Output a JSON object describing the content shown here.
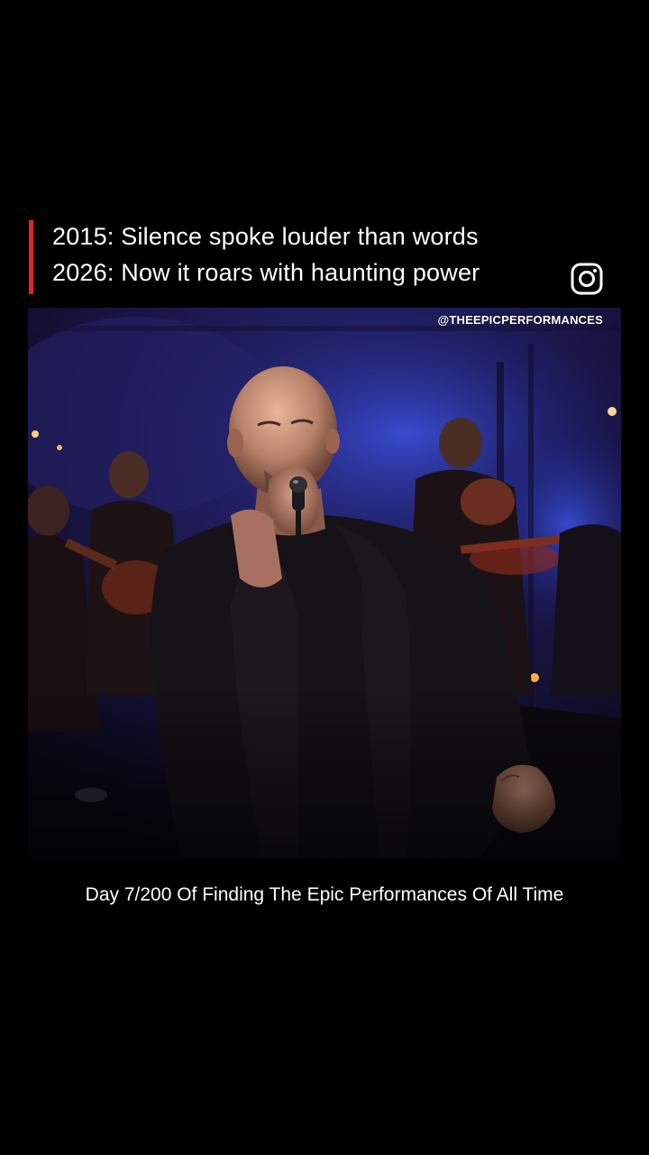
{
  "caption": {
    "line1": "2015: Silence spoke louder than words",
    "line2": "2026: Now it roars with haunting power",
    "accent_color": "#e2232a"
  },
  "instagram": {
    "icon": "instagram-icon"
  },
  "video": {
    "watermark": "@THEEPICPERFORMANCES",
    "subject": "bald singer in black jacket singing into microphone with orchestra behind"
  },
  "footer": {
    "text": "Day 7/200 Of Finding The Epic Performances Of All Time"
  }
}
